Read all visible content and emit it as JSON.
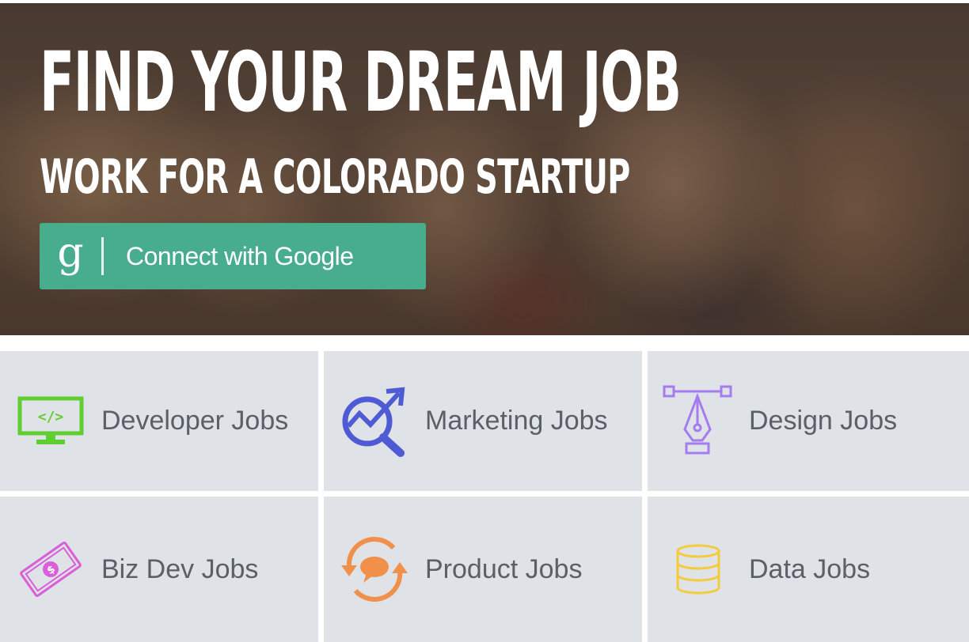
{
  "hero": {
    "title": "FIND YOUR DREAM JOB",
    "subtitle": "WORK FOR A COLORADO STARTUP",
    "connect_button": {
      "icon_glyph": "g",
      "label": "Connect with Google",
      "color": "#48ad8d"
    }
  },
  "job_categories": [
    {
      "label": "Developer Jobs",
      "icon": "monitor-code-icon",
      "color": "#5fce2f"
    },
    {
      "label": "Marketing Jobs",
      "icon": "chart-magnifier-icon",
      "color": "#4f5bd5"
    },
    {
      "label": "Design Jobs",
      "icon": "pen-tool-icon",
      "color": "#a57cf0"
    },
    {
      "label": "Biz Dev Jobs",
      "icon": "money-bill-icon",
      "color": "#d85fd8"
    },
    {
      "label": "Product Jobs",
      "icon": "chat-cycle-icon",
      "color": "#f0904a"
    },
    {
      "label": "Data Jobs",
      "icon": "database-icon",
      "color": "#f2cc3c"
    }
  ]
}
